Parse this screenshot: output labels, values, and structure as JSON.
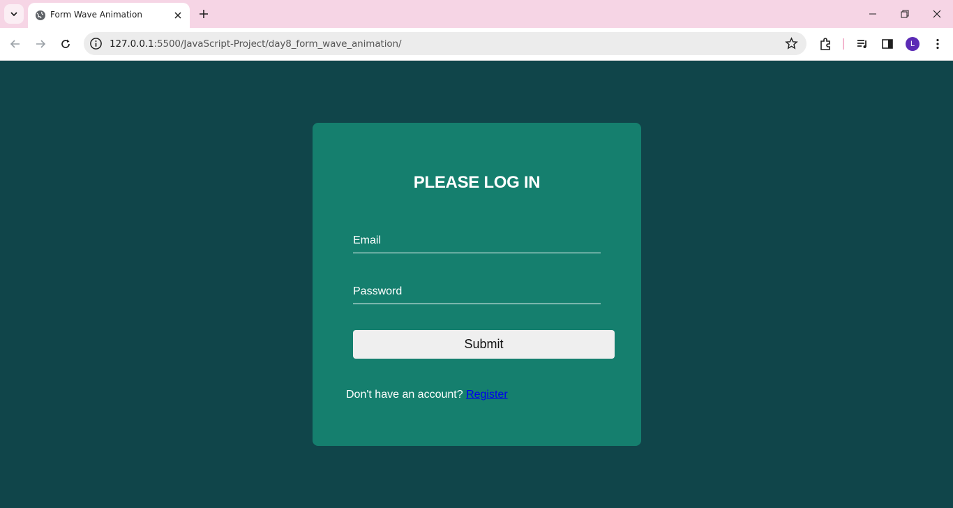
{
  "browser": {
    "tab_title": "Form Wave Animation",
    "url_host": "127.0.0.1",
    "url_rest": ":5500/JavaScript-Project/day8_form_wave_animation/",
    "avatar_letter": "L"
  },
  "login": {
    "heading": "PLEASE LOG IN",
    "email_label": "Email",
    "password_label": "Password",
    "submit_label": "Submit",
    "footer_text": "Don't have an account?",
    "register_link": "Register"
  },
  "colors": {
    "page_bg": "#10454a",
    "card_bg": "#157f6e",
    "titlebar_bg": "#f6d5e5"
  }
}
